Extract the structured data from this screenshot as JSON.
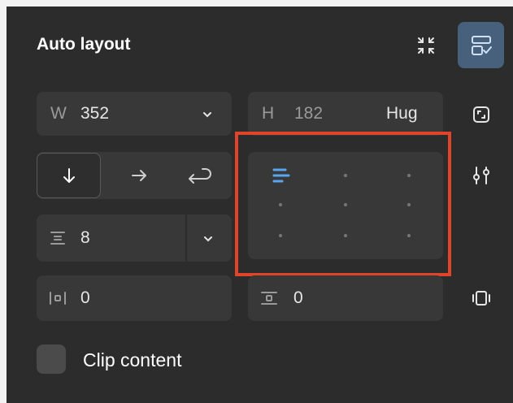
{
  "panel": {
    "title": "Auto layout",
    "accent_color": "#47607c",
    "highlight_color": "#e0452c"
  },
  "width_field": {
    "label": "W",
    "value": "352",
    "icon": "chevron-down-icon"
  },
  "height_field": {
    "label": "H",
    "value": "182",
    "mode": "Hug"
  },
  "direction": {
    "options": [
      {
        "icon": "arrow-down-icon",
        "selected": true
      },
      {
        "icon": "arrow-right-icon",
        "selected": false
      },
      {
        "icon": "wrap-icon",
        "selected": false
      }
    ]
  },
  "gap_field": {
    "icon": "gap-icon",
    "value": "8"
  },
  "padding": {
    "horizontal": {
      "icon": "horizontal-padding-icon",
      "value": "0"
    },
    "vertical": {
      "icon": "vertical-padding-icon",
      "value": "0"
    }
  },
  "alignment": {
    "selected": "top-left"
  },
  "side_icons": [
    "resize-icon",
    "settings-sliders-icon",
    "padding-box-icon"
  ],
  "clip_content": {
    "label": "Clip content",
    "checked": false
  }
}
